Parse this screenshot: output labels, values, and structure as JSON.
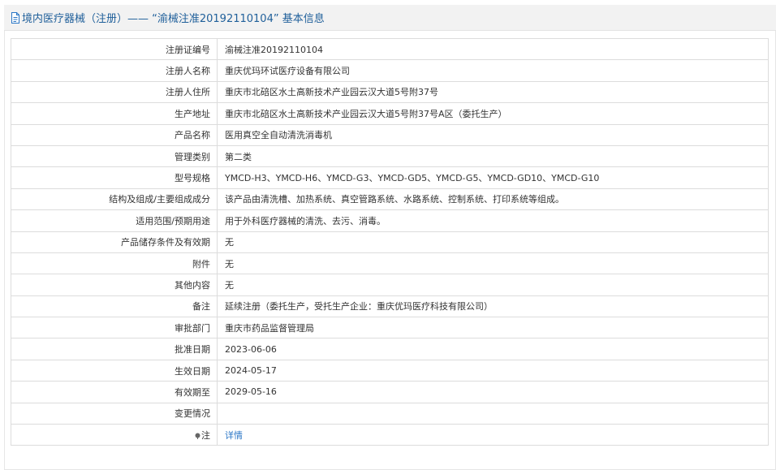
{
  "header": {
    "title": "境内医疗器械（注册）—— “渝械注准20192110104” 基本信息"
  },
  "icons": {
    "header": "document-icon",
    "note": "pin-icon"
  },
  "colors": {
    "title": "#1f5f9a",
    "link": "#2a76c6",
    "header_bg": "#f2f2f2",
    "border": "#dcdcdc"
  },
  "rows": [
    {
      "label": "注册证编号",
      "value": "渝械注准20192110104"
    },
    {
      "label": "注册人名称",
      "value": "重庆优玛环试医疗设备有限公司"
    },
    {
      "label": "注册人住所",
      "value": "重庆市北碚区水土高新技术产业园云汉大道5号附37号"
    },
    {
      "label": "生产地址",
      "value": "重庆市北碚区水土高新技术产业园云汉大道5号附37号A区（委托生产）"
    },
    {
      "label": "产品名称",
      "value": "医用真空全自动清洗消毒机"
    },
    {
      "label": "管理类别",
      "value": "第二类"
    },
    {
      "label": "型号规格",
      "value": "YMCD-H3、YMCD-H6、YMCD-G3、YMCD-GD5、YMCD-G5、YMCD-GD10、YMCD-G10"
    },
    {
      "label": "结构及组成/主要组成成分",
      "value": "该产品由清洗槽、加热系统、真空管路系统、水路系统、控制系统、打印系统等组成。"
    },
    {
      "label": "适用范围/预期用途",
      "value": "用于外科医疗器械的清洗、去污、消毒。"
    },
    {
      "label": "产品储存条件及有效期",
      "value": "无"
    },
    {
      "label": "附件",
      "value": "无"
    },
    {
      "label": "其他内容",
      "value": "无"
    },
    {
      "label": "备注",
      "value": "延续注册（委托生产，受托生产企业：重庆优玛医疗科技有限公司）"
    },
    {
      "label": "审批部门",
      "value": "重庆市药品监督管理局"
    },
    {
      "label": "批准日期",
      "value": "2023-06-06"
    },
    {
      "label": "生效日期",
      "value": "2024-05-17"
    },
    {
      "label": "有效期至",
      "value": "2029-05-16"
    },
    {
      "label": "变更情况",
      "value": ""
    },
    {
      "label": "注",
      "value": "详情"
    }
  ]
}
